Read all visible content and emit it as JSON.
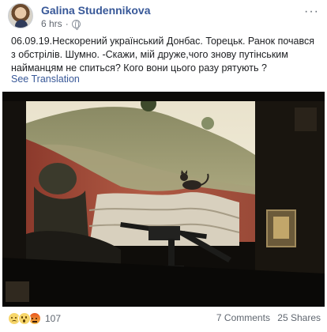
{
  "post": {
    "author": "Galina Studennikova",
    "time": "6 hrs",
    "dot": "·",
    "more_menu": "···",
    "text": "06.09.19.Нескорений український Донбас. Торецьк. Ранок почався з обстрілів. Шумно. -Скажи, мій друже,чого знову путінським найманцям не спиться? Кого вони цього разу рятують ?",
    "see_translation": "See Translation",
    "photo_icon": "war-photo-soldier-cat"
  },
  "footer": {
    "reactions": [
      "sad",
      "wow",
      "angry"
    ],
    "reaction_count": "107",
    "comments": "7 Comments",
    "shares": "25 Shares"
  },
  "colors": {
    "link": "#385898",
    "meta": "#616770",
    "text": "#1c1e21"
  }
}
